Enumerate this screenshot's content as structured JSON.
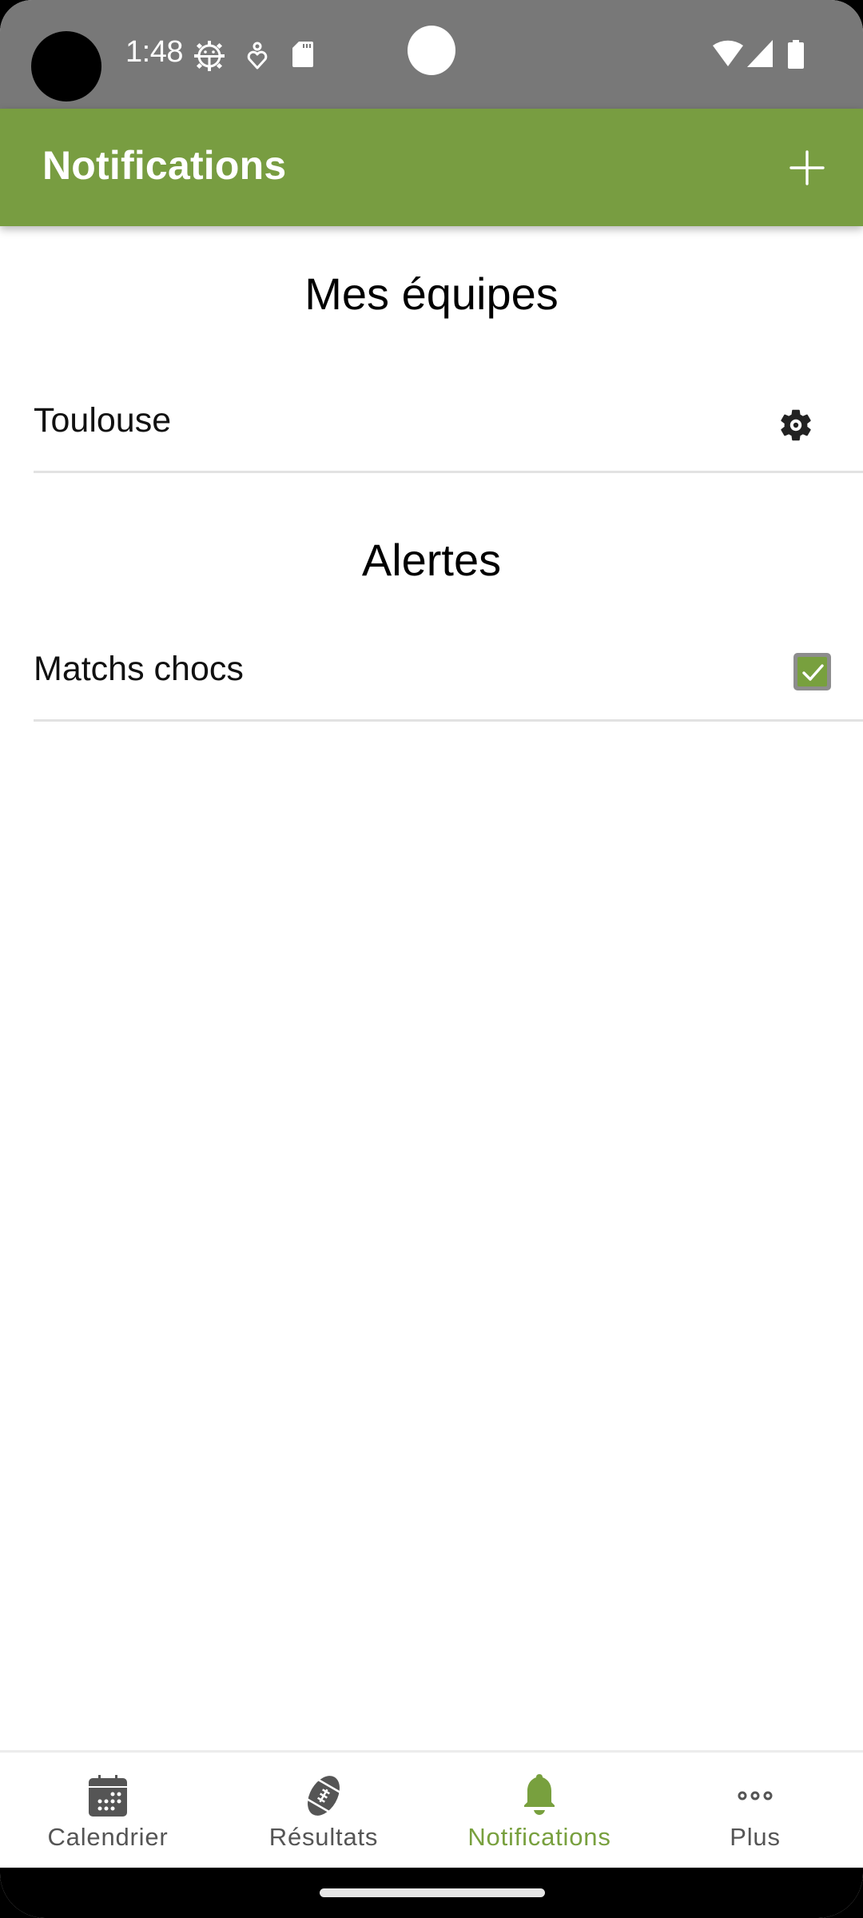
{
  "status_bar": {
    "time": "1:48",
    "left_icons": [
      "android-debug-icon",
      "heart-person-icon",
      "sd-card-icon"
    ],
    "right_icons": [
      "wifi-icon",
      "cell-signal-icon",
      "battery-icon"
    ]
  },
  "app_bar": {
    "title": "Notifications",
    "action_icon": "plus-icon",
    "background_color": "#789d41"
  },
  "sections": [
    {
      "title": "Mes équipes",
      "items": [
        {
          "label": "Toulouse",
          "action_icon": "gear-icon"
        }
      ]
    },
    {
      "title": "Alertes",
      "items": [
        {
          "label": "Matchs chocs",
          "checked": true
        }
      ]
    }
  ],
  "bottom_nav": {
    "active_index": 2,
    "active_color": "#78a03e",
    "items": [
      {
        "label": "Calendrier",
        "icon": "calendar-icon"
      },
      {
        "label": "Résultats",
        "icon": "rugby-ball-icon"
      },
      {
        "label": "Notifications",
        "icon": "bell-icon"
      },
      {
        "label": "Plus",
        "icon": "more-dots-icon"
      }
    ]
  }
}
